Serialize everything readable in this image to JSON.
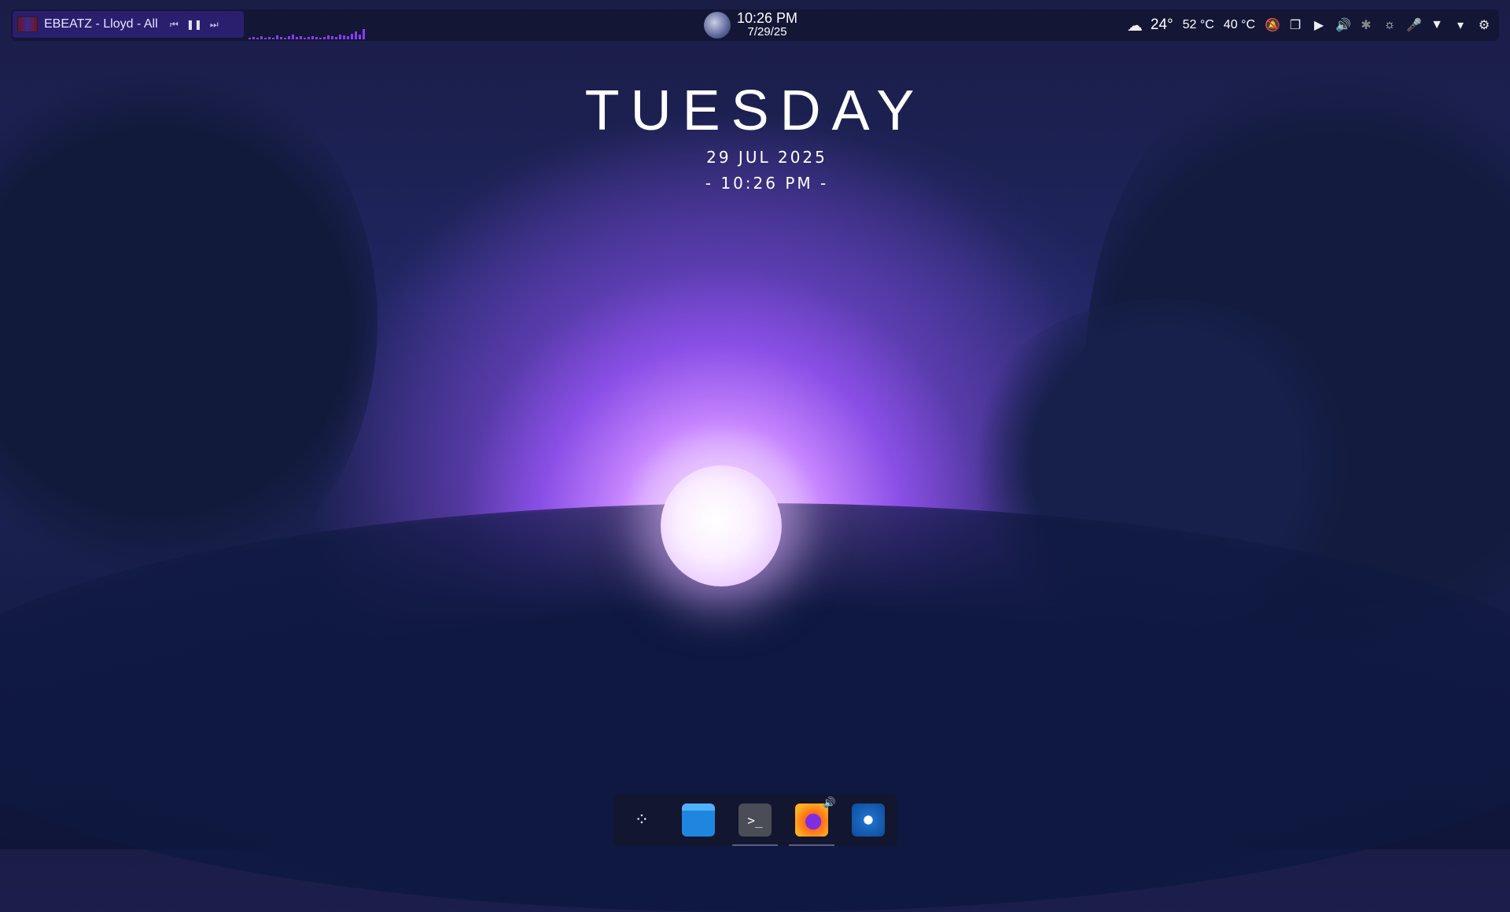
{
  "top_bar": {
    "media": {
      "track": "EBEATZ - Lloyd - All I",
      "prev_icon": "skip-back-icon",
      "pause_icon": "pause-icon",
      "next_icon": "skip-forward-icon",
      "prev_glyph": "⏮",
      "pause_glyph": "❚❚",
      "next_glyph": "⏭"
    },
    "clock": {
      "time": "10:26 PM",
      "date": "7/29/25"
    },
    "tray": {
      "weather_icon": "cloud-icon",
      "weather_glyph": "☁",
      "outside_temp": "24°",
      "cpu_temp": "52 °C",
      "gpu_temp": "40 °C",
      "icons": [
        {
          "name": "notifications-off-icon",
          "glyph": "🔕"
        },
        {
          "name": "clipboard-icon",
          "glyph": "❐"
        },
        {
          "name": "media-play-icon",
          "glyph": "▶"
        },
        {
          "name": "volume-icon",
          "glyph": "🔊"
        },
        {
          "name": "bluetooth-icon",
          "glyph": "✱"
        },
        {
          "name": "brightness-icon",
          "glyph": "☼"
        },
        {
          "name": "microphone-icon",
          "glyph": "🎤"
        },
        {
          "name": "wifi-icon",
          "glyph": "▼"
        },
        {
          "name": "chevron-down-icon",
          "glyph": "▾"
        },
        {
          "name": "settings-icon",
          "glyph": "⚙"
        }
      ]
    }
  },
  "desktop_widget": {
    "day": "TUESDAY",
    "date": "29 JUL 2025",
    "time": "- 10:26 PM -"
  },
  "dock": {
    "apps": [
      {
        "name": "application-launcher-icon",
        "glyph": "⁘",
        "running": false
      },
      {
        "name": "file-manager-icon",
        "glyph": "",
        "running": false
      },
      {
        "name": "terminal-icon",
        "glyph": ">_",
        "running": true
      },
      {
        "name": "firefox-icon",
        "glyph": "",
        "running": true
      },
      {
        "name": "steam-icon",
        "glyph": "",
        "running": false
      }
    ],
    "audio_badge_glyph": "🔊"
  }
}
